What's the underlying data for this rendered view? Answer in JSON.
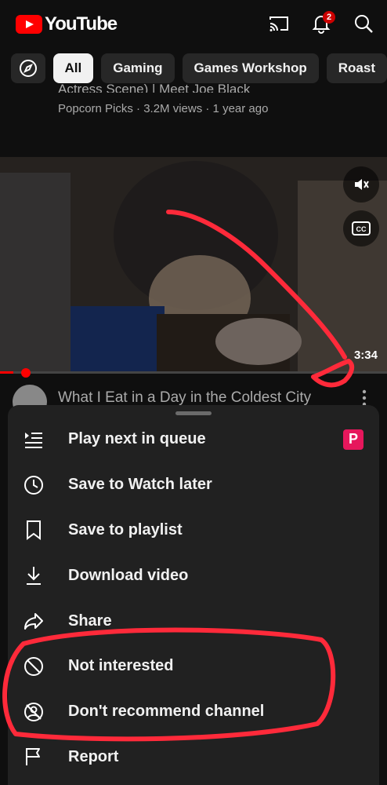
{
  "app": {
    "name": "YouTube"
  },
  "header": {
    "notifications_count": "2"
  },
  "chips": [
    "All",
    "Gaming",
    "Games Workshop",
    "Roast"
  ],
  "previous_video": {
    "title": "Actress Scene) | Meet Joe Black",
    "meta": "Popcorn Picks · 3.2M views · 1 year ago"
  },
  "video": {
    "title": "What I Eat in a Day in the Coldest City",
    "duration": "3:34",
    "progress_fraction": 0.035
  },
  "sheet": {
    "items": [
      {
        "label": "Play next in queue",
        "icon": "queue-next-icon"
      },
      {
        "label": "Save to Watch later",
        "icon": "clock-icon"
      },
      {
        "label": "Save to playlist",
        "icon": "bookmark-icon"
      },
      {
        "label": "Download video",
        "icon": "download-icon"
      },
      {
        "label": "Share",
        "icon": "share-icon"
      },
      {
        "label": "Not interested",
        "icon": "block-icon"
      },
      {
        "label": "Don't recommend channel",
        "icon": "channel-block-icon"
      },
      {
        "label": "Report",
        "icon": "flag-icon"
      }
    ],
    "premium_badge": "P"
  },
  "colors": {
    "accent": "#ff0000",
    "annotation": "#ff2a3a",
    "premium": "#e6175c"
  }
}
